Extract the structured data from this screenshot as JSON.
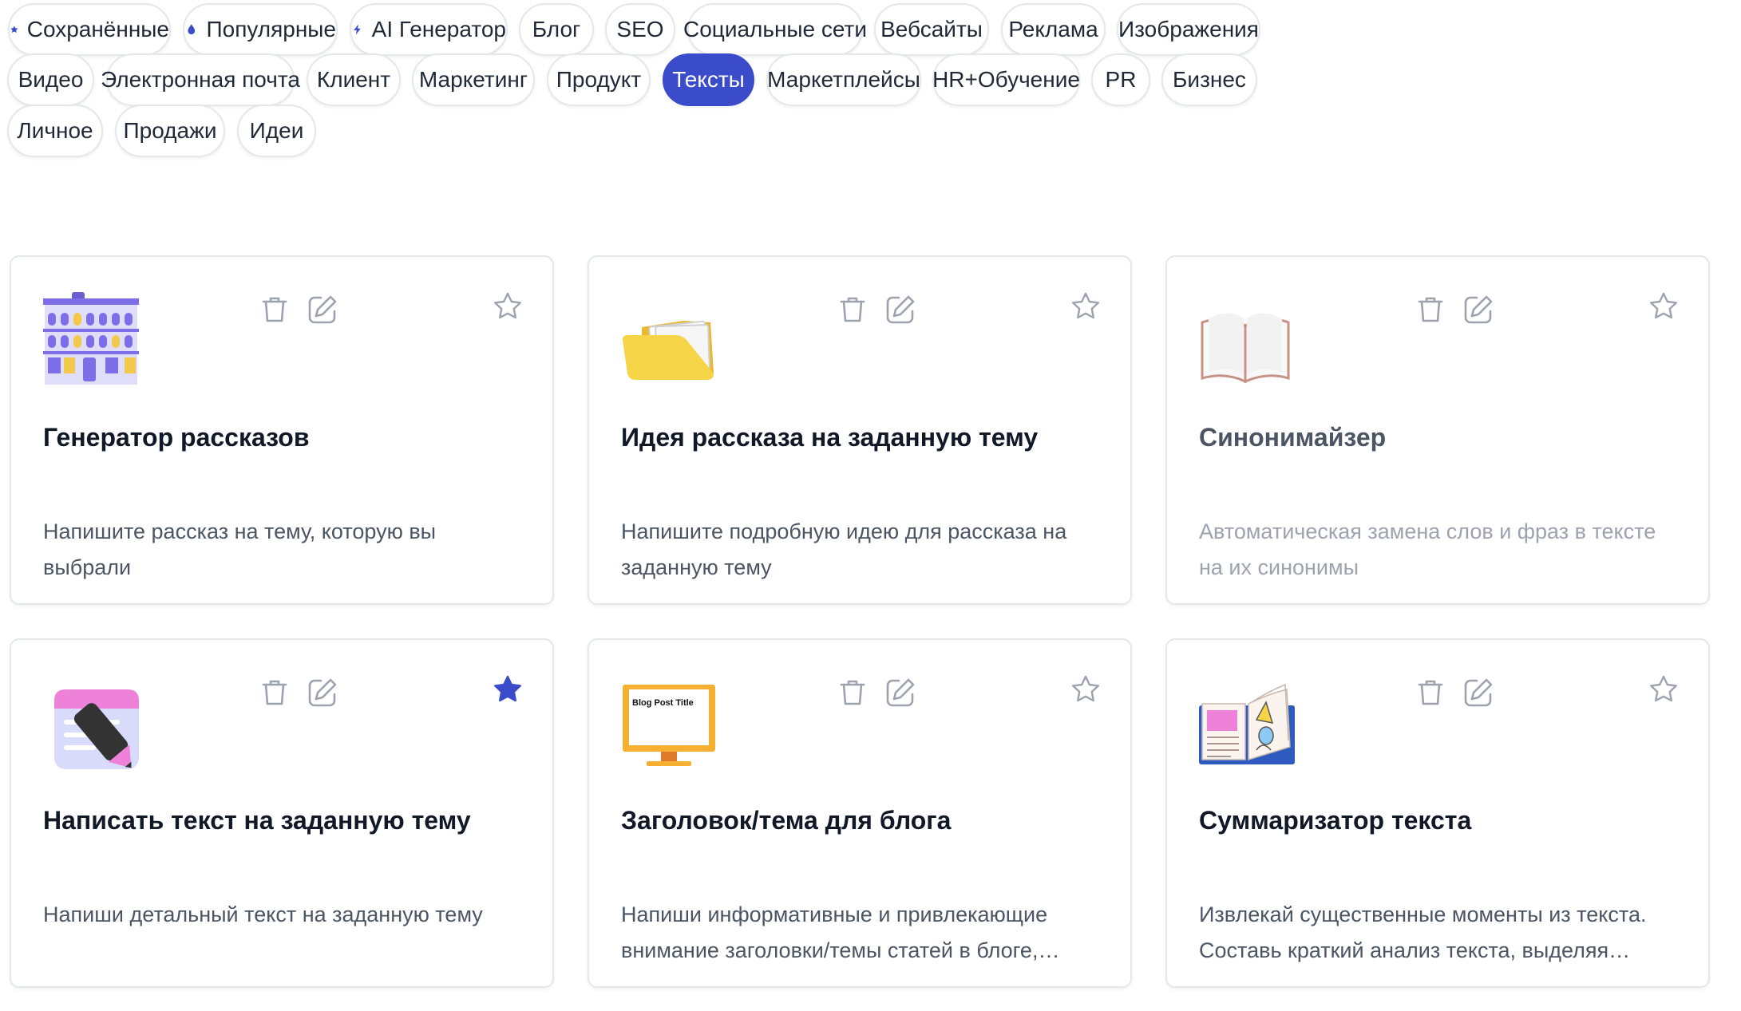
{
  "categories": [
    {
      "label": "Сохранённые",
      "icon": "star-icon"
    },
    {
      "label": "Популярные",
      "icon": "drop-icon"
    },
    {
      "label": "AI Генератор",
      "icon": "bolt-icon"
    },
    {
      "label": "Блог"
    },
    {
      "label": "SEO"
    },
    {
      "label": "Социальные сети"
    },
    {
      "label": "Вебсайты"
    },
    {
      "label": "Реклама"
    },
    {
      "label": "Изображения"
    },
    {
      "label": "Видео"
    },
    {
      "label": "Электронная почта"
    },
    {
      "label": "Клиент"
    },
    {
      "label": "Маркетинг"
    },
    {
      "label": "Продукт"
    },
    {
      "label": "Тексты",
      "active": true
    },
    {
      "label": "Маркетплейсы"
    },
    {
      "label": "HR+Обучение"
    },
    {
      "label": "PR"
    },
    {
      "label": "Бизнес"
    },
    {
      "label": "Личное"
    },
    {
      "label": "Продажи"
    },
    {
      "label": "Идеи"
    }
  ],
  "colors": {
    "accent": "#3b4cca",
    "border": "#e5e7eb",
    "text": "#111827",
    "muted": "#4b5563"
  },
  "cards": [
    {
      "title": "Генератор рассказов",
      "desc": "Напишите рассказ на тему, которую вы выбрали",
      "icon": "building-icon",
      "starred": false
    },
    {
      "title": "Идея рассказа на заданную тему",
      "desc": "Напишите подробную идею для рассказа на заданную тему",
      "icon": "folder-icon",
      "starred": false
    },
    {
      "title": "Синонимайзер",
      "desc": "Автоматическая замена слов и фраз в тексте на их синонимы",
      "icon": "open-book-icon",
      "starred": false,
      "dimmed": true
    },
    {
      "title": "Написать текст на заданную тему",
      "desc": "Напиши детальный текст на заданную тему",
      "icon": "notepad-pen-icon",
      "starred": true
    },
    {
      "title": "Заголовок/тема для блога",
      "desc": "Напиши информативные и привлекающие внимание заголовки/темы статей в блоге, используя ключевые слова",
      "icon": "monitor-icon",
      "starred": false,
      "monitor_text": "Blog Post Title"
    },
    {
      "title": "Суммаризатор текста",
      "desc": "Извлекай существенные моменты из текста. Составь краткий анализ текста, выделяя главное",
      "icon": "book-diagram-icon",
      "starred": false
    }
  ]
}
